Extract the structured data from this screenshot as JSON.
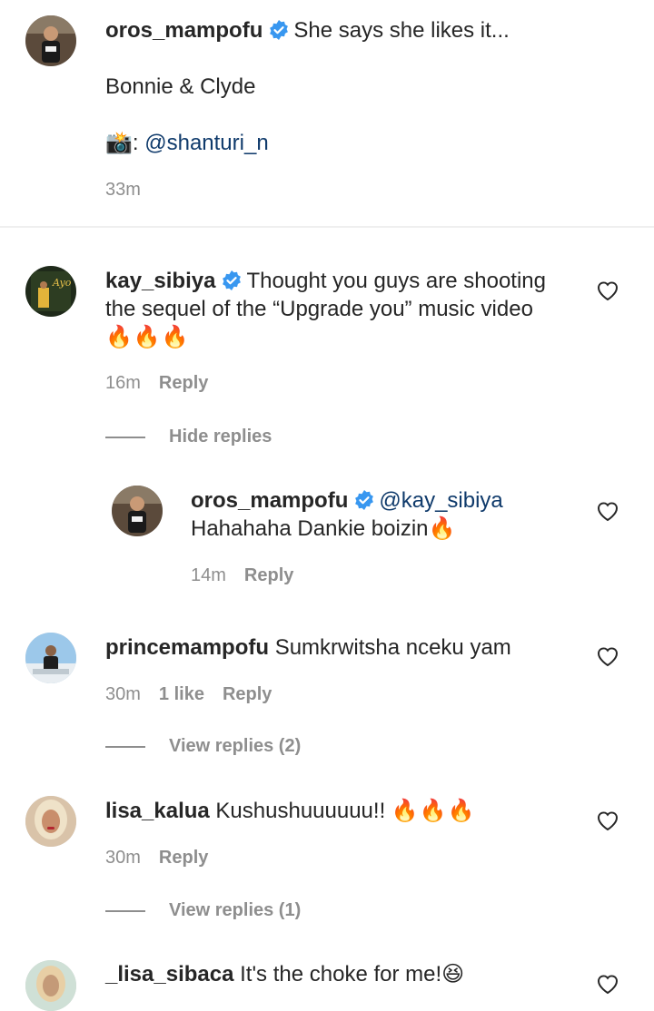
{
  "caption": {
    "username": "oros_mampofu",
    "line1": "She says she likes it...",
    "line2": "Bonnie & Clyde",
    "camera_emoji": "📸",
    "credit_sep": ":",
    "credit_handle": "@shanturi_n",
    "time": "33m"
  },
  "comments": [
    {
      "username": "kay_sibiya",
      "verified": true,
      "text_line1": "Thought you guys are shooting",
      "text_line2": "the sequel of the “Upgrade you” music video",
      "emoji": "🔥🔥🔥",
      "time": "16m",
      "reply_label": "Reply",
      "thread_toggle": "Hide replies",
      "replies": [
        {
          "username": "oros_mampofu",
          "verified": true,
          "mention": "@kay_sibiya",
          "text": "Hahahaha Dankie boizin",
          "emoji": "🔥",
          "time": "14m",
          "reply_label": "Reply"
        }
      ]
    },
    {
      "username": "princemampofu",
      "text": "Sumkrwitsha nceku yam",
      "time": "30m",
      "likes": "1 like",
      "reply_label": "Reply",
      "thread_toggle": "View replies (2)"
    },
    {
      "username": "lisa_kalua",
      "text": "Kushushuuuuuu!!",
      "emoji": "🔥🔥🔥",
      "time": "30m",
      "reply_label": "Reply",
      "thread_toggle": "View replies (1)"
    },
    {
      "username": "_lisa_sibaca",
      "text": "It's the choke for me!",
      "emoji": "😆"
    }
  ],
  "colors": {
    "text": "#262626",
    "secondary": "#8e8e8e",
    "link": "#0f3a6b",
    "verified": "#3897f0"
  },
  "icons": [
    "verified-badge-icon",
    "heart-outline-icon"
  ]
}
